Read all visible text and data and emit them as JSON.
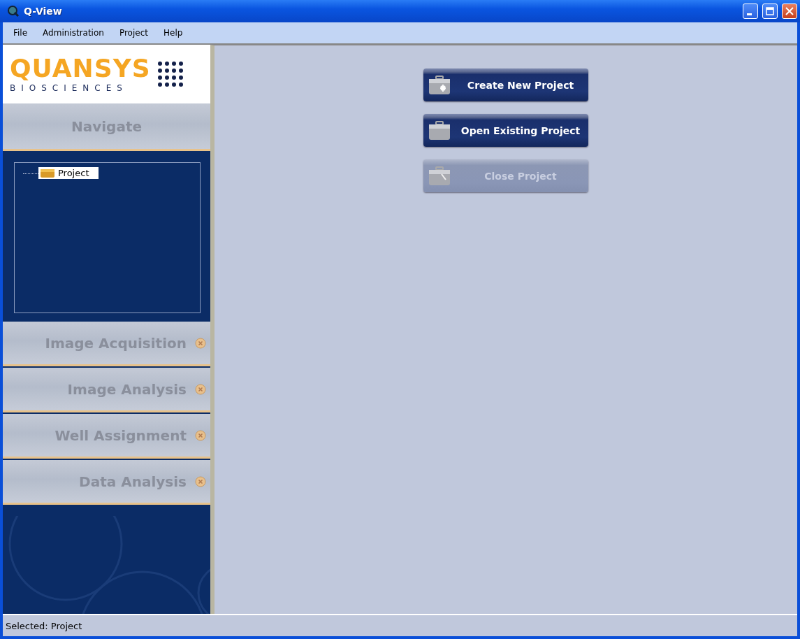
{
  "window": {
    "title": "Q-View"
  },
  "menu": [
    "File",
    "Administration",
    "Project",
    "Help"
  ],
  "logo": {
    "name": "QUANSYS",
    "tagline": "BIOSCIENCES"
  },
  "sections": [
    {
      "label": "Navigate",
      "expanded": true,
      "tree": [
        {
          "label": "Project",
          "selected": true
        }
      ]
    },
    {
      "label": "Image Acquisition",
      "expanded": false
    },
    {
      "label": "Image Analysis",
      "expanded": false
    },
    {
      "label": "Well Assignment",
      "expanded": false
    },
    {
      "label": "Data Analysis",
      "expanded": false
    }
  ],
  "actions": [
    {
      "label": "Create New Project",
      "kind": "new",
      "disabled": false
    },
    {
      "label": "Open Existing Project",
      "kind": "open",
      "disabled": false
    },
    {
      "label": "Close Project",
      "kind": "close",
      "disabled": true
    }
  ],
  "status_bar": "Selected: Project"
}
